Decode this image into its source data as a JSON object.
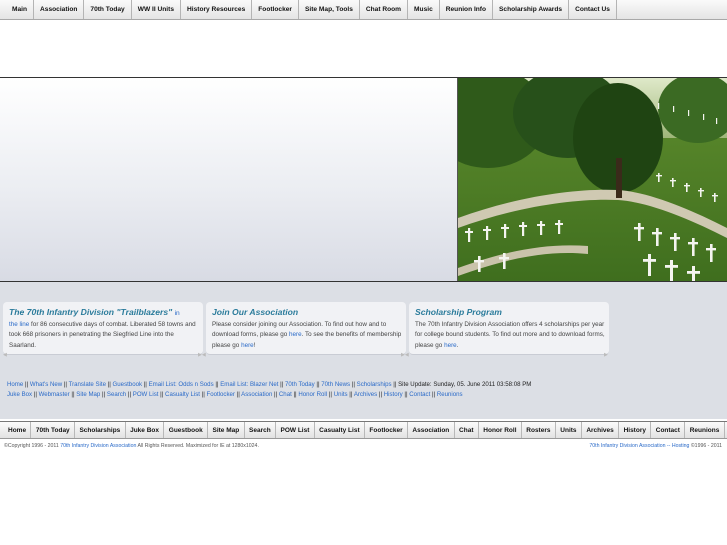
{
  "top_nav": [
    "Main",
    "Association",
    "70th Today",
    "WW II Units",
    "History Resources",
    "Footlocker",
    "Site Map, Tools",
    "Chat Room",
    "Music",
    "Reunion Info",
    "Scholarship Awards",
    "Contact Us"
  ],
  "hero": {
    "photo": "cemetery-crosses-photo"
  },
  "cards": [
    {
      "title": "The 70th Infantry Division \"Trailblazers\"",
      "title_link": "in",
      "body_link": "the line",
      "body": " for 86 consecutive days of combat. Liberated 58 towns and took 668 prisoners in penetrating the Siegfried Line into the Saarland."
    },
    {
      "title": "Join Our Association",
      "body_a": "Please consider joining our Association. To find out how and to download forms, please go ",
      "link_a": "here",
      "body_b": ". To see the benefits of membership please go ",
      "link_b": "here",
      "body_c": "!"
    },
    {
      "title": "Scholarship Program",
      "body_a": "The 70th Infantry Division Association offers 4 scholarships per year for college bound students. To find out more and to download forms, please go ",
      "link_a": "here",
      "body_b": "."
    }
  ],
  "links_row1": [
    "Home",
    "What's New",
    "Translate Site",
    "Guestbook",
    "Email List: Odds n Sods",
    "Email List: Blazer Net",
    "70th Today",
    "70th News",
    "Scholarships"
  ],
  "site_update": "Site Update: Sunday, 05. June 2011 03:58:08 PM",
  "links_row2": [
    "Juke Box",
    "Webmaster",
    "Site Map",
    "Search",
    "POW List",
    "Casualty List",
    "Footlocker",
    "Association",
    "Chat",
    "Honor Roll",
    "Units",
    "Archives",
    "History",
    "Contact",
    "Reunions"
  ],
  "bottom_nav": [
    "Home",
    "70th Today",
    "Scholarships",
    "Juke Box",
    "Guestbook",
    "Site Map",
    "Search",
    "POW List",
    "Casualty List",
    "Footlocker",
    "Association",
    "Chat",
    "Honor Roll",
    "Rosters",
    "Units",
    "Archives",
    "History",
    "Contact",
    "Reunions"
  ],
  "footer": {
    "copyright_a": "©Copyright 1996 - 2011 ",
    "copyright_link": "70th Infantry Division Association",
    "copyright_b": " All Rights Reserved. Maximized for IE at 1280x1024.",
    "hosting_link": "70th Infantry Division Association -- Hosting",
    "hosting_b": " ©1996 - 2011"
  }
}
